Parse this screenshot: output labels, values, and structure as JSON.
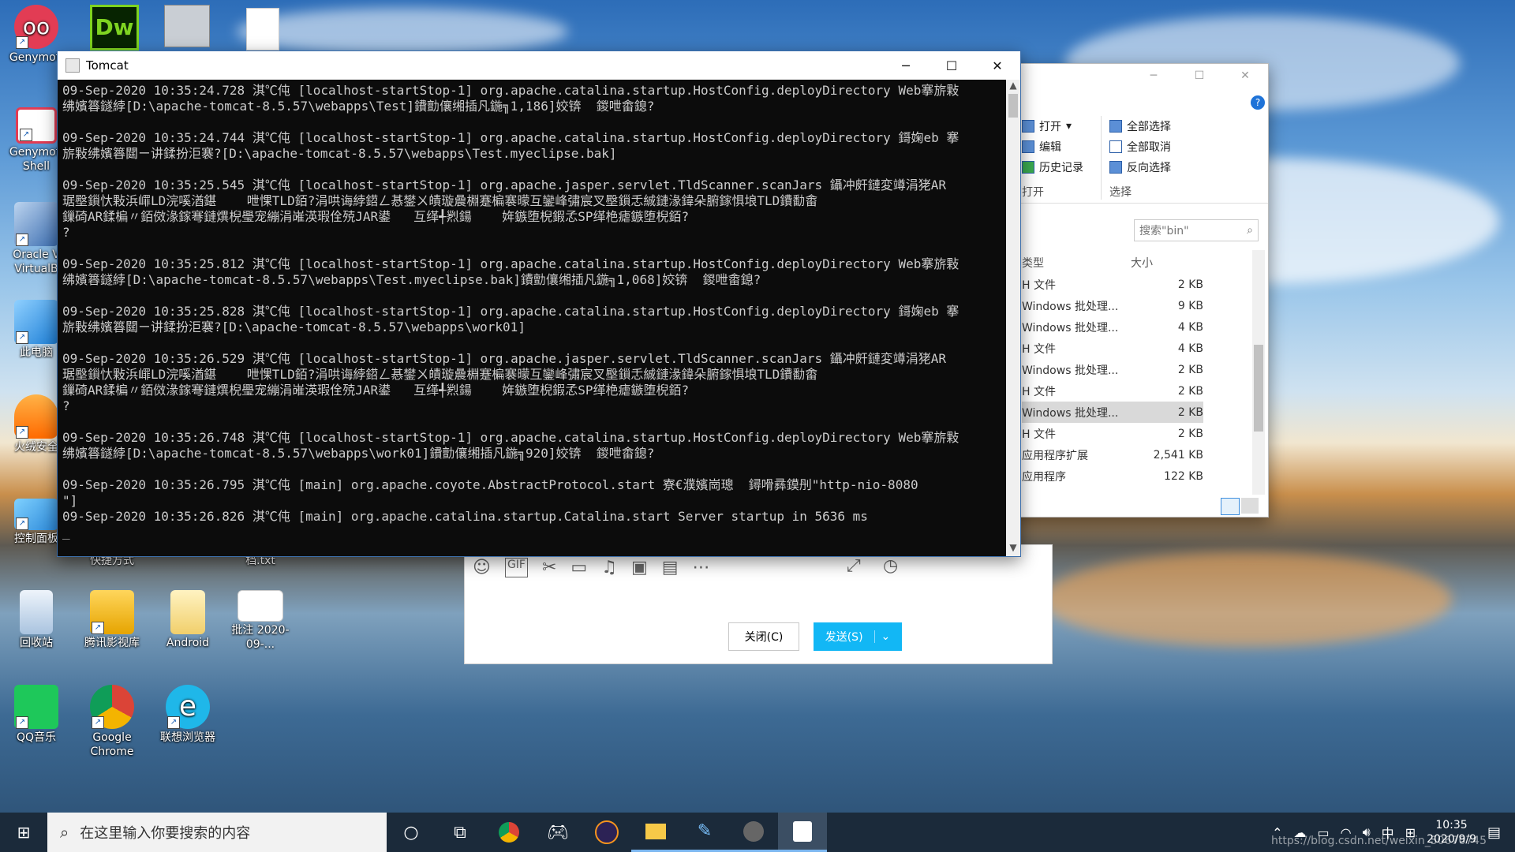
{
  "desktop": {
    "icons": [
      {
        "label": "Genymoti"
      },
      {
        "label": "Genymoti Shell"
      },
      {
        "label": "Oracle V VirtualB"
      },
      {
        "label": "此电脑"
      },
      {
        "label": "火绒安全"
      },
      {
        "label": "控制面板"
      },
      {
        "label": "回收站"
      },
      {
        "label": "腾讯影视库"
      },
      {
        "label": "Android"
      },
      {
        "label": "批注 2020-09-..."
      },
      {
        "label": "QQ音乐"
      },
      {
        "label": "Google Chrome"
      },
      {
        "label": "联想浏览器"
      },
      {
        "label": "快捷方式"
      },
      {
        "label": "档.txt"
      }
    ],
    "top_icons": [
      "Dw"
    ]
  },
  "tomcat": {
    "title": "Tomcat",
    "controls": {
      "minimize": "─",
      "maximize": "☐",
      "close": "✕"
    },
    "log_lines": [
      "09-Sep-2020 10:35:24.728 淇℃伅 [localhost-startStop-1] org.apache.catalina.startup.HostConfig.deployDirectory Web搴旂敤",
      "绋嬪簭鐩綍[D:\\apache-tomcat-8.5.57\\webapps\\Test]鐨勯儴缃插凡鍦╗1,186]姣锛  鍐呭畬鎴?",
      "",
      "09-Sep-2020 10:35:24.744 淇℃伅 [localhost-startStop-1] org.apache.catalina.startup.HostConfig.deployDirectory 鎶婅eb 搴",
      "旂敤绋嬪簭閮ㄧ讲鍒扮洰褰?[D:\\apache-tomcat-8.5.57\\webapps\\Test.myeclipse.bak]",
      "",
      "09-Sep-2020 10:35:25.545 淇℃伅 [localhost-startStop-1] org.apache.jasper.servlet.TldScanner.scanJars 鑷冲皯鏈変竴涓狫AR",
      "琚壂鎻忕敤浜嶵LD浣嗘湭鍖    呭惈TLD銆?涓哄诲綍鍣ㄥ惎鐢ㄨ皟璇曟棩蹇楄褰曚互鑾峰彇宸叉壂鎻忎絾鏈湪鍏朵腑鎵惧埌TLD鐨勫畬",
      "鏁碕AR鍒楄〃銆傚湪鎵弿鏈熼棿璺宠繃涓嶉渶瑕佺殑JAR鍙   互缂╃煭鍚    姩鏃堕棿鍜孞SP缂栬瘧鏃堕棿銆?",
      "?",
      "",
      "09-Sep-2020 10:35:25.812 淇℃伅 [localhost-startStop-1] org.apache.catalina.startup.HostConfig.deployDirectory Web搴旂敤",
      "绋嬪簭鐩綍[D:\\apache-tomcat-8.5.57\\webapps\\Test.myeclipse.bak]鐨勯儴缃插凡鍦╗1,068]姣锛  鍐呭畬鎴?",
      "",
      "09-Sep-2020 10:35:25.828 淇℃伅 [localhost-startStop-1] org.apache.catalina.startup.HostConfig.deployDirectory 鎶婅eb 搴",
      "旂敤绋嬪簭閮ㄧ讲鍒扮洰褰?[D:\\apache-tomcat-8.5.57\\webapps\\work01]",
      "",
      "09-Sep-2020 10:35:26.529 淇℃伅 [localhost-startStop-1] org.apache.jasper.servlet.TldScanner.scanJars 鑷冲皯鏈変竴涓狫AR",
      "琚壂鎻忕敤浜嶵LD浣嗘湭鍖    呭惈TLD銆?涓哄诲綍鍣ㄥ惎鐢ㄨ皟璇曟棩蹇楄褰曚互鑾峰彇宸叉壂鎻忎絾鏈湪鍏朵腑鎵惧埌TLD鐨勫畬",
      "鏁碕AR鍒楄〃銆傚湪鎵弿鏈熼棿璺宠繃涓嶉渶瑕佺殑JAR鍙   互缂╃煭鍚    姩鏃堕棿鍜孞SP缂栬瘧鏃堕棿銆?",
      "?",
      "",
      "09-Sep-2020 10:35:26.748 淇℃伅 [localhost-startStop-1] org.apache.catalina.startup.HostConfig.deployDirectory Web搴旂敤",
      "绋嬪簭鐩綍[D:\\apache-tomcat-8.5.57\\webapps\\work01]鐨勯儴缃插凡鍦╗920]姣锛  鍐呭畬鎴?",
      "",
      "09-Sep-2020 10:35:26.795 淇℃伅 [main] org.apache.coyote.AbstractProtocol.start 寮€濮嬪崗璁  鐞嗗彞鏌刐\"http-nio-8080",
      "\"]",
      "09-Sep-2020 10:35:26.826 淇℃伅 [main] org.apache.catalina.startup.Catalina.start Server startup in 5636 ms",
      "_"
    ]
  },
  "explorer": {
    "ribbon": {
      "open": "打开",
      "edit": "编辑",
      "history": "历史记录",
      "group_open": "打开",
      "select_all": "全部选择",
      "select_none": "全部取消",
      "invert": "反向选择",
      "group_select": "选择"
    },
    "search_placeholder": "搜索\"bin\"",
    "columns": {
      "type": "类型",
      "size": "大小"
    },
    "rows": [
      {
        "type": "H 文件",
        "size": "2 KB"
      },
      {
        "type": "Windows 批处理...",
        "size": "9 KB"
      },
      {
        "type": "Windows 批处理...",
        "size": "4 KB"
      },
      {
        "type": "H 文件",
        "size": "4 KB"
      },
      {
        "type": "Windows 批处理...",
        "size": "2 KB"
      },
      {
        "type": "H 文件",
        "size": "2 KB"
      },
      {
        "type": "Windows 批处理...",
        "size": "2 KB"
      },
      {
        "type": "H 文件",
        "size": "2 KB"
      },
      {
        "type": "应用程序扩展",
        "size": "2,541 KB"
      },
      {
        "type": "应用程序",
        "size": "122 KB"
      }
    ]
  },
  "chat": {
    "close_label": "关闭(C)",
    "send_label": "发送(S)",
    "toolbar_icons": [
      "emoji-icon",
      "gif-icon",
      "scissors-icon",
      "folder-icon",
      "music-icon",
      "image-icon",
      "video-icon",
      "more-icon"
    ]
  },
  "taskbar": {
    "search_placeholder": "在这里输入你要搜索的内容",
    "time": "10:35",
    "date": "2020/9/9",
    "ime": "中",
    "watermark": "https://blog.csdn.net/weixin_50676745"
  },
  "colors": {
    "console_bg": "#0c0c0c",
    "console_fg": "#cccccc",
    "accent": "#12b7f5",
    "taskbar": "#1b2a3a"
  }
}
